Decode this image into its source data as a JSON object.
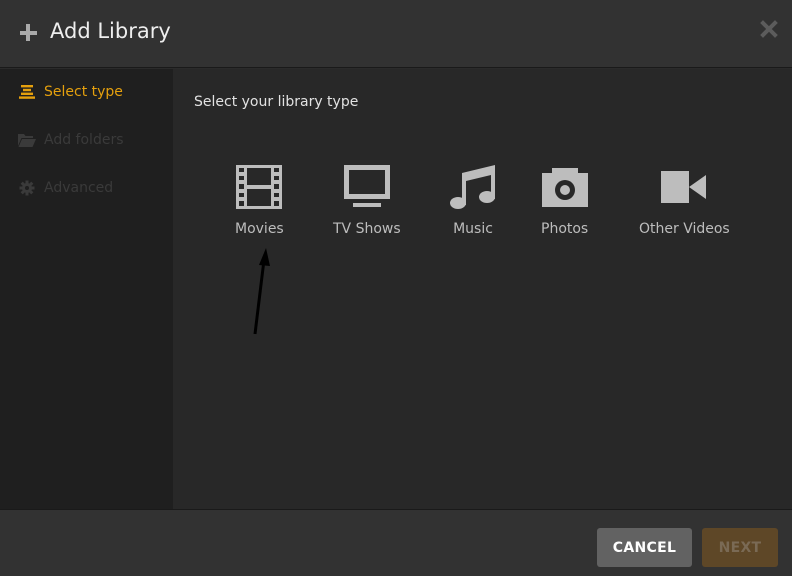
{
  "dialog": {
    "title": "Add Library",
    "title_icon": "plus-icon",
    "close_icon": "close-icon"
  },
  "sidebar": {
    "items": [
      {
        "label": "Select type",
        "icon": "list-icon",
        "state": "active"
      },
      {
        "label": "Add folders",
        "icon": "folder-icon",
        "state": "disabled"
      },
      {
        "label": "Advanced",
        "icon": "gear-icon",
        "state": "disabled"
      }
    ]
  },
  "main": {
    "heading": "Select your library type",
    "types": [
      {
        "label": "Movies",
        "icon": "film-icon"
      },
      {
        "label": "TV Shows",
        "icon": "tv-icon"
      },
      {
        "label": "Music",
        "icon": "music-note-icon"
      },
      {
        "label": "Photos",
        "icon": "camera-icon"
      },
      {
        "label": "Other Videos",
        "icon": "video-camera-icon"
      }
    ],
    "annotation": "arrow pointing to Movies"
  },
  "footer": {
    "cancel_label": "CANCEL",
    "next_label": "NEXT"
  },
  "colors": {
    "accent": "#e5a00d",
    "cancel_bg": "#626262",
    "next_bg_disabled": "#5e4727"
  }
}
